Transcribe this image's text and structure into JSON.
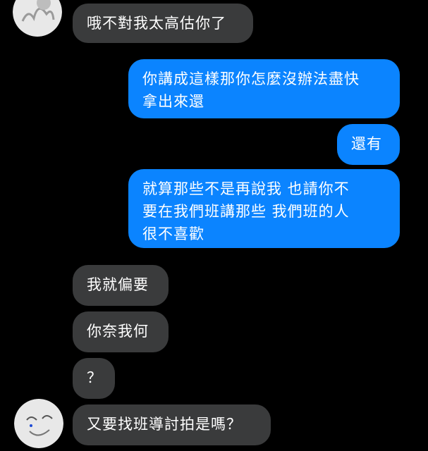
{
  "messages": [
    {
      "side": "received",
      "text": "哦不對我太高估你了"
    },
    {
      "side": "sent",
      "text": "你講成這樣那你怎麼沒辦法盡快\n拿出來還"
    },
    {
      "side": "sent",
      "text": "還有"
    },
    {
      "side": "sent",
      "text": "就算那些不是再說我 也請你不\n要在我們班講那些 我們班的人\n很不喜歡"
    },
    {
      "side": "received",
      "text": "我就偏要"
    },
    {
      "side": "received",
      "text": "你奈我何"
    },
    {
      "side": "received",
      "text": "？"
    },
    {
      "side": "received",
      "text": "又要找班導討拍是嗎？"
    }
  ],
  "colors": {
    "background": "#000000",
    "received_bubble": "#3a3b3c",
    "sent_bubble": "#0b84ff",
    "text": "#ffffff"
  },
  "icons": {
    "avatar": "contact-avatar-icon"
  }
}
